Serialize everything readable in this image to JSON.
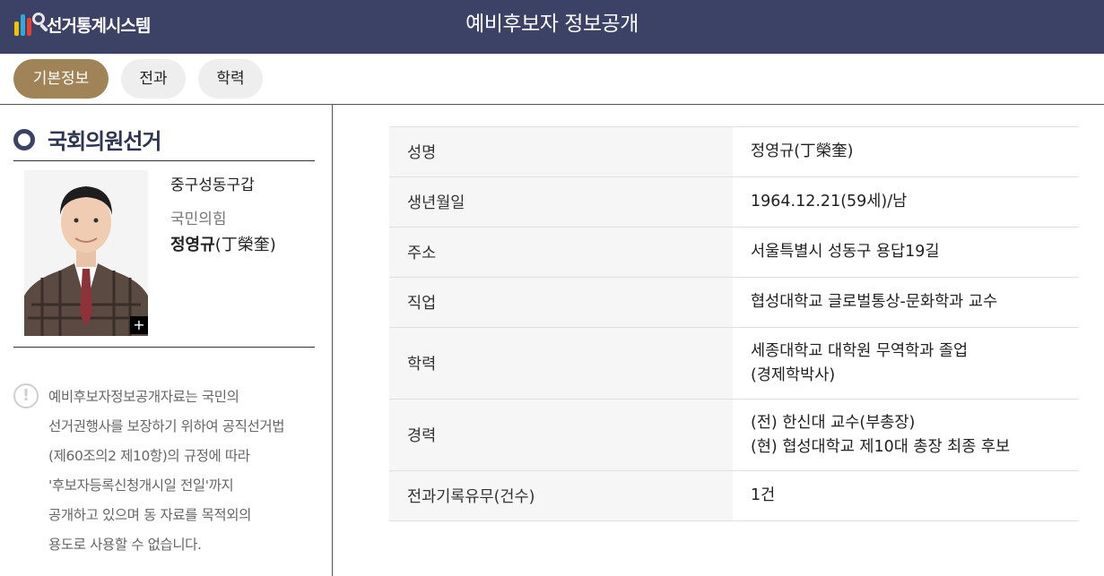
{
  "header": {
    "logo_text": "선거통계시스템",
    "title": "예비후보자 정보공개",
    "background": "#3b4266"
  },
  "tabs": [
    {
      "label": "기본정보",
      "active": true
    },
    {
      "label": "전과",
      "active": false
    },
    {
      "label": "학력",
      "active": false
    }
  ],
  "accent_color": "#a08457",
  "election": {
    "title": "국회의원선거",
    "icon": "ring-icon"
  },
  "candidate": {
    "district": "중구성동구갑",
    "party": "국민의힘",
    "name_bold": "정영규",
    "name_hanja": "(丁榮奎)",
    "photo_expand_label": "+"
  },
  "notice": {
    "icon": "exclamation-icon",
    "lines": [
      "예비후보자정보공개자료는 국민의",
      "선거권행사를 보장하기 위하여 공직선거법",
      "(제60조의2 제10항)의 규정에 따라",
      "'후보자등록신청개시일 전일'까지",
      "공개하고 있으며 동 자료를 목적외의",
      "용도로 사용할 수 없습니다."
    ]
  },
  "info_rows": [
    {
      "label": "성명",
      "value1": "정영규(丁榮奎)",
      "value2": ""
    },
    {
      "label": "생년월일",
      "value1": "1964.12.21(59세)/남",
      "value2": ""
    },
    {
      "label": "주소",
      "value1": "서울특별시 성동구 용답19길",
      "value2": ""
    },
    {
      "label": "직업",
      "value1": "협성대학교 글로벌통상-문화학과 교수",
      "value2": ""
    },
    {
      "label": "학력",
      "value1": "세종대학교 대학원 무역학과 졸업",
      "value2": "(경제학박사)"
    },
    {
      "label": "경력",
      "value1": "(전) 한신대 교수(부총장)",
      "value2": "(현) 협성대학교 제10대 총장 최종 후보"
    },
    {
      "label": "전과기록유무(건수)",
      "value1": "1건",
      "value2": ""
    }
  ]
}
